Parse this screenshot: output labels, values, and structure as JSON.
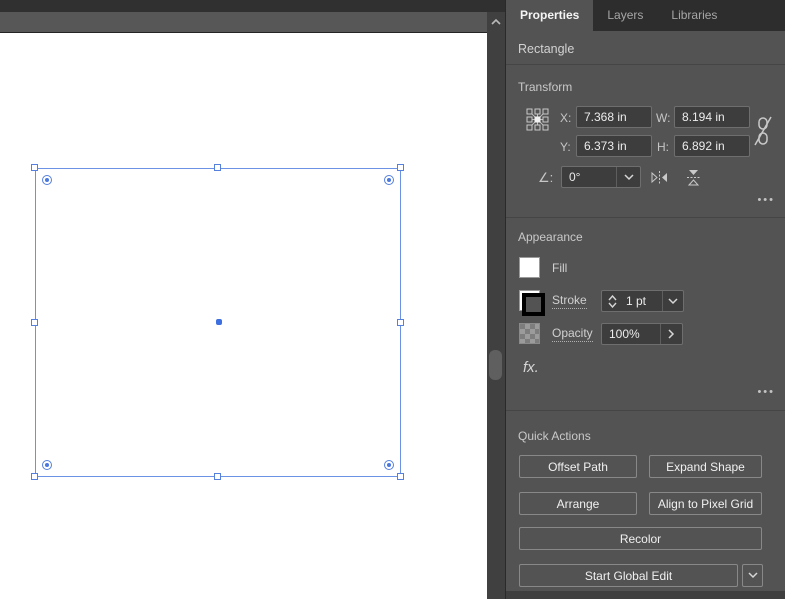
{
  "panel": {
    "tabs": [
      {
        "label": "Properties"
      },
      {
        "label": "Layers"
      },
      {
        "label": "Libraries"
      }
    ],
    "object_type": "Rectangle",
    "transform": {
      "title": "Transform",
      "x": {
        "label": "X:",
        "value": "7.368 in"
      },
      "y": {
        "label": "Y:",
        "value": "6.373 in"
      },
      "w": {
        "label": "W:",
        "value": "8.194 in"
      },
      "h": {
        "label": "H:",
        "value": "6.892 in"
      },
      "rotate": {
        "label": "∠:",
        "value": "0°"
      },
      "more": "•••"
    },
    "appearance": {
      "title": "Appearance",
      "fill": {
        "label": "Fill"
      },
      "stroke": {
        "label": "Stroke",
        "weight": "1 pt"
      },
      "opacity": {
        "label": "Opacity",
        "value": "100%"
      },
      "fx": "fx.",
      "more": "•••"
    },
    "quick_actions": {
      "title": "Quick Actions",
      "buttons": [
        "Offset Path",
        "Expand Shape",
        "Arrange",
        "Align to Pixel Grid",
        "Recolor",
        "Start Global Edit"
      ]
    }
  },
  "colors": {
    "panel_bg": "#535353",
    "tabbar_bg": "#2d2d2d",
    "field_bg": "#3d3d3d",
    "field_border": "#6e6e6e",
    "selection_blue": "#6b92e5",
    "canvas_bg": "#ffffff",
    "fill_swatch": "#ffffff",
    "stroke_swatch": "#000000"
  }
}
